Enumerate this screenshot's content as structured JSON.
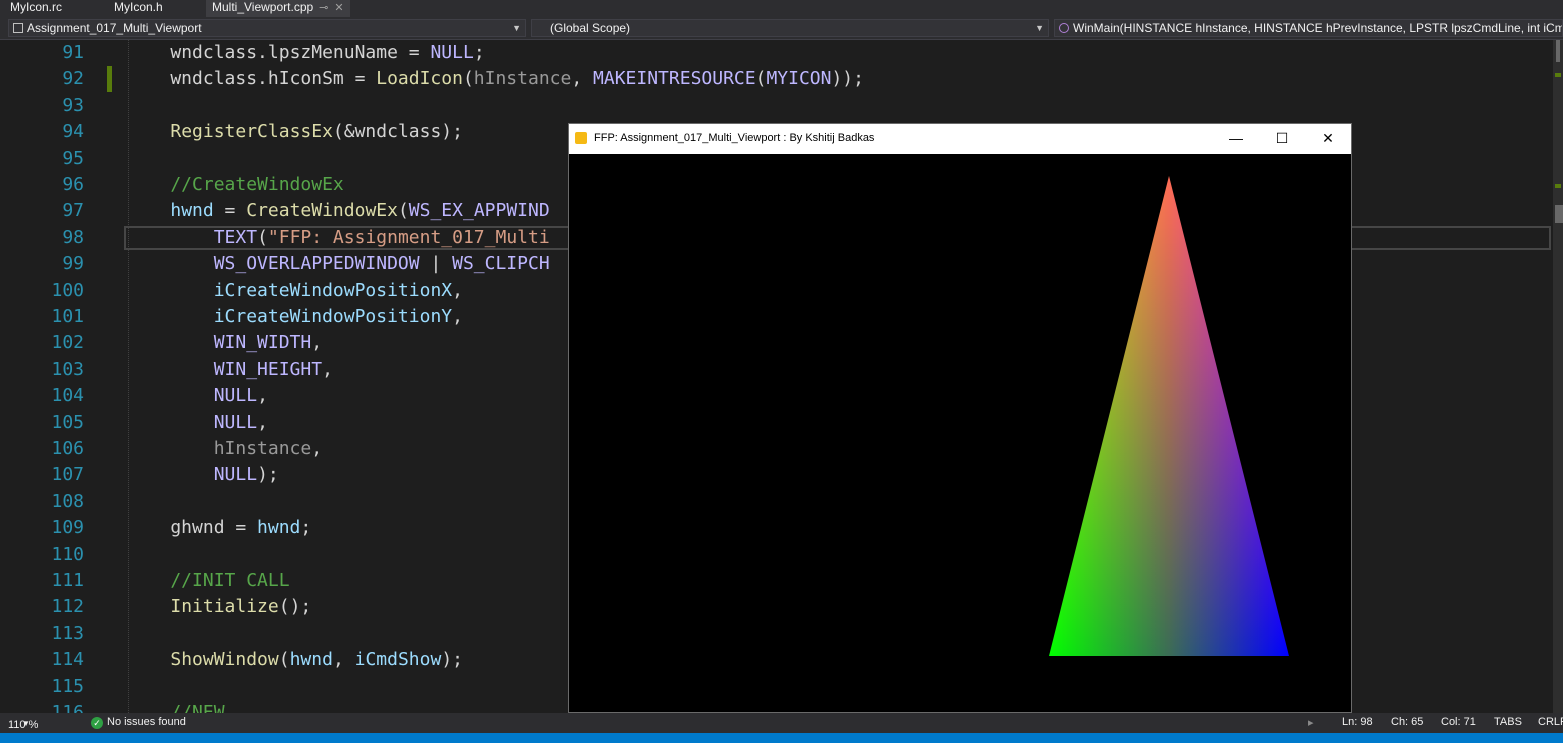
{
  "tabs": [
    {
      "label": "MyIcon.rc"
    },
    {
      "label": "MyIcon.h"
    },
    {
      "label": "Multi_Viewport.cpp",
      "active": true
    }
  ],
  "nav": {
    "project": "Assignment_017_Multi_Viewport",
    "scope": "(Global Scope)",
    "function": "WinMain(HINSTANCE hInstance, HINSTANCE hPrevInstance, LPSTR lpszCmdLine, int iCmdSh"
  },
  "code_lines": [
    {
      "num": "91",
      "tokens": [
        [
          "k",
          "    "
        ],
        [
          "k",
          "wndclass.lpszMenuName = "
        ],
        [
          "mac",
          "NULL"
        ],
        [
          "k",
          ";"
        ]
      ]
    },
    {
      "num": "92",
      "tokens": [
        [
          "k",
          "    wndclass.hIconSm = "
        ],
        [
          "fn",
          "LoadIcon"
        ],
        [
          "k",
          "("
        ],
        [
          "par",
          "hInstance"
        ],
        [
          "k",
          ", "
        ],
        [
          "mac",
          "MAKEINTRESOURCE"
        ],
        [
          "k",
          "("
        ],
        [
          "mac",
          "MYICON"
        ],
        [
          "k",
          "));"
        ]
      ]
    },
    {
      "num": "93",
      "tokens": []
    },
    {
      "num": "94",
      "tokens": [
        [
          "k",
          "    "
        ],
        [
          "fn",
          "RegisterClassEx"
        ],
        [
          "k",
          "(&wndclass);"
        ]
      ]
    },
    {
      "num": "95",
      "tokens": []
    },
    {
      "num": "96",
      "tokens": [
        [
          "cmt",
          "    //CreateWindowEx"
        ]
      ]
    },
    {
      "num": "97",
      "tokens": [
        [
          "k",
          "    "
        ],
        [
          "var",
          "hwnd"
        ],
        [
          "k",
          " = "
        ],
        [
          "fn",
          "CreateWindowEx"
        ],
        [
          "k",
          "("
        ],
        [
          "mac",
          "WS_EX_APPWIND"
        ]
      ]
    },
    {
      "num": "98",
      "tokens": [
        [
          "k",
          "        "
        ],
        [
          "mac",
          "TEXT"
        ],
        [
          "k",
          "("
        ],
        [
          "str",
          "\"FFP: Assignment_017_Multi"
        ]
      ]
    },
    {
      "num": "99",
      "tokens": [
        [
          "k",
          "        "
        ],
        [
          "mac",
          "WS_OVERLAPPEDWINDOW"
        ],
        [
          "k",
          " | "
        ],
        [
          "mac",
          "WS_CLIPCH"
        ]
      ]
    },
    {
      "num": "100",
      "tokens": [
        [
          "k",
          "        "
        ],
        [
          "var",
          "iCreateWindowPositionX"
        ],
        [
          "k",
          ","
        ]
      ]
    },
    {
      "num": "101",
      "tokens": [
        [
          "k",
          "        "
        ],
        [
          "var",
          "iCreateWindowPositionY"
        ],
        [
          "k",
          ","
        ]
      ]
    },
    {
      "num": "102",
      "tokens": [
        [
          "k",
          "        "
        ],
        [
          "mac",
          "WIN_WIDTH"
        ],
        [
          "k",
          ","
        ]
      ]
    },
    {
      "num": "103",
      "tokens": [
        [
          "k",
          "        "
        ],
        [
          "mac",
          "WIN_HEIGHT"
        ],
        [
          "k",
          ","
        ]
      ]
    },
    {
      "num": "104",
      "tokens": [
        [
          "k",
          "        "
        ],
        [
          "mac",
          "NULL"
        ],
        [
          "k",
          ","
        ]
      ]
    },
    {
      "num": "105",
      "tokens": [
        [
          "k",
          "        "
        ],
        [
          "mac",
          "NULL"
        ],
        [
          "k",
          ","
        ]
      ]
    },
    {
      "num": "106",
      "tokens": [
        [
          "k",
          "        "
        ],
        [
          "par",
          "hInstance"
        ],
        [
          "k",
          ","
        ]
      ]
    },
    {
      "num": "107",
      "tokens": [
        [
          "k",
          "        "
        ],
        [
          "mac",
          "NULL"
        ],
        [
          "k",
          ");"
        ]
      ]
    },
    {
      "num": "108",
      "tokens": []
    },
    {
      "num": "109",
      "tokens": [
        [
          "k",
          "    ghwnd = "
        ],
        [
          "var",
          "hwnd"
        ],
        [
          "k",
          ";"
        ]
      ]
    },
    {
      "num": "110",
      "tokens": []
    },
    {
      "num": "111",
      "tokens": [
        [
          "cmt",
          "    //INIT CALL"
        ]
      ]
    },
    {
      "num": "112",
      "tokens": [
        [
          "k",
          "    "
        ],
        [
          "fn",
          "Initialize"
        ],
        [
          "k",
          "();"
        ]
      ]
    },
    {
      "num": "113",
      "tokens": []
    },
    {
      "num": "114",
      "tokens": [
        [
          "k",
          "    "
        ],
        [
          "fn",
          "ShowWindow"
        ],
        [
          "k",
          "("
        ],
        [
          "var",
          "hwnd"
        ],
        [
          "k",
          ", "
        ],
        [
          "var",
          "iCmdShow"
        ],
        [
          "k",
          ");"
        ]
      ]
    },
    {
      "num": "115",
      "tokens": []
    },
    {
      "num": "116",
      "tokens": [
        [
          "cmt",
          "    //NEW"
        ]
      ]
    }
  ],
  "status": {
    "zoom": "110 %",
    "issues": "No issues found",
    "ln": "Ln: 98",
    "ch": "Ch: 65",
    "col": "Col: 71",
    "tabs": "TABS",
    "eol": "CRLF"
  },
  "window": {
    "title": "FFP: Assignment_017_Multi_Viewport : By Kshitij Badkas",
    "minimize": "—",
    "maximize": "☐",
    "close": "✕"
  },
  "colors": {
    "triangle_top": "#ff0000",
    "triangle_left": "#00ff00",
    "triangle_right": "#0000ff"
  }
}
